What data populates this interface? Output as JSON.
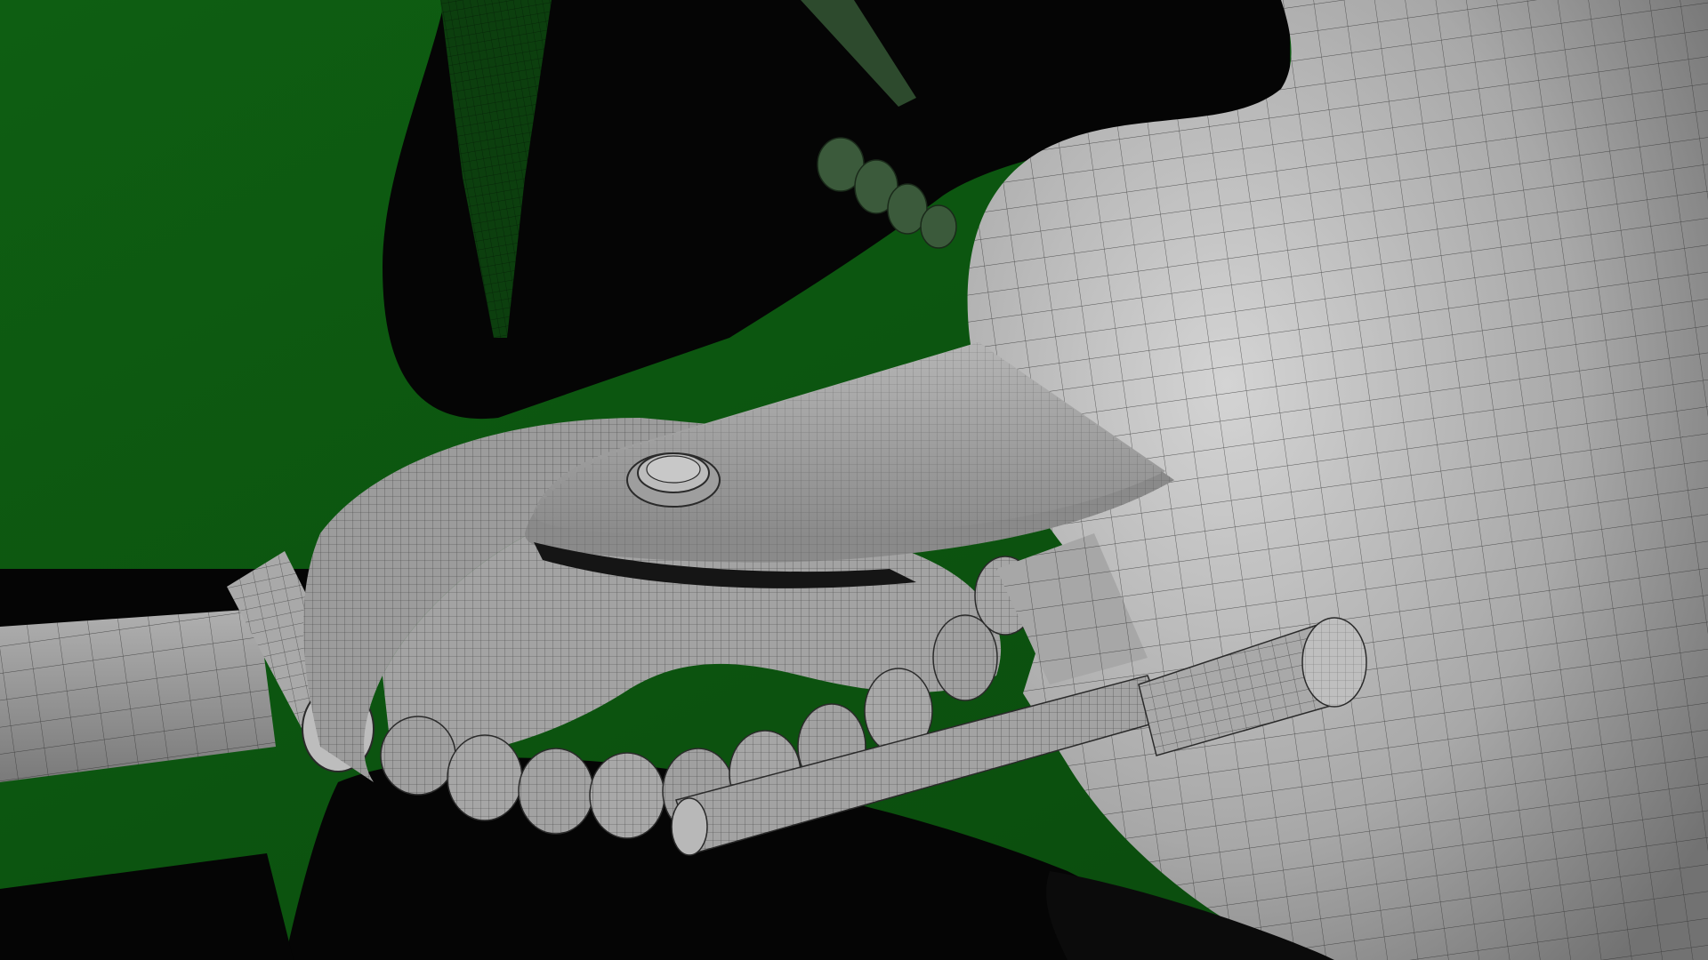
{
  "scene": {
    "kind": "3d-wireframe-render",
    "colors": {
      "background_green": "#0f5a12",
      "background_green_dark": "#083a0b",
      "shadow_black": "#050505",
      "mesh_gray_light": "#c9c9c9",
      "mesh_gray_mid": "#9a9a9a",
      "mesh_gray_dark": "#6a6a6a",
      "wire_line": "#2a2a2a"
    },
    "objects": [
      {
        "name": "green-backdrop"
      },
      {
        "name": "shadow-silhouette"
      },
      {
        "name": "dark-spike"
      },
      {
        "name": "body-shell"
      },
      {
        "name": "rear-wheel-shadow"
      },
      {
        "name": "left-rail"
      },
      {
        "name": "roller-cylinder"
      },
      {
        "name": "curved-gear-frame"
      },
      {
        "name": "gear-teeth"
      },
      {
        "name": "top-plate"
      },
      {
        "name": "pivot-bolt"
      },
      {
        "name": "lower-bracket"
      },
      {
        "name": "side-handle"
      },
      {
        "name": "auger-shaft"
      }
    ]
  }
}
